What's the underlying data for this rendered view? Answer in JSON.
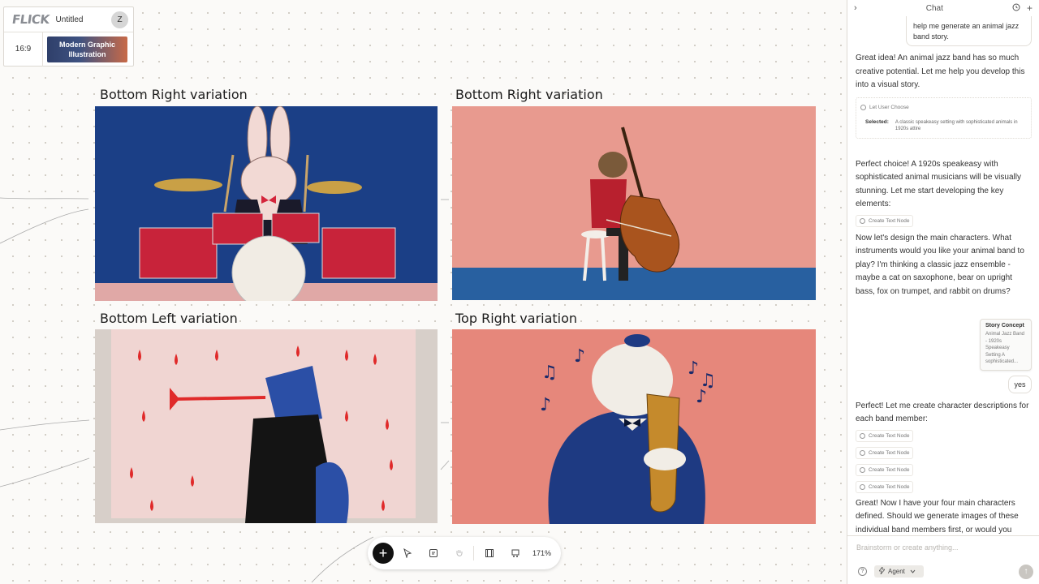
{
  "app": {
    "logo": "FLICK",
    "file_title": "Untitled",
    "user_initial": "Z",
    "aspect_ratio": "16:9",
    "style_line1": "Modern Graphic",
    "style_line2": "Illustration"
  },
  "panels": [
    {
      "title": "Bottom Right variation",
      "scene": "rabbit-drummer"
    },
    {
      "title": "Bottom Right variation",
      "scene": "bear-bassist"
    },
    {
      "title": "Bottom Left variation",
      "scene": "wolf-trumpeter"
    },
    {
      "title": "Top Right variation",
      "scene": "cat-saxophonist"
    }
  ],
  "toolbar": {
    "zoom": "171%",
    "icons": [
      "add-icon",
      "pointer-icon",
      "note-icon",
      "hand-icon",
      "film-icon",
      "frames-icon"
    ]
  },
  "chat": {
    "title": "Chat",
    "messages": {
      "user_1": "help me generate an animal jazz band story.",
      "ai_1": "Great idea! An animal jazz band has so much creative potential. Let me help you develop this into a visual story.",
      "tool_choose": "Let User Choose",
      "selected_label": "Selected:",
      "selected_value": "A classic speakeasy setting with sophisticated animals in 1920s attire",
      "ai_2": "Perfect choice! A 1920s speakeasy with sophisticated animal musicians will be visually stunning. Let me start developing the key elements:",
      "tool_text_node": "Create Text Node",
      "ai_3": "Now let's design the main characters. What instruments would you like your animal band to play? I'm thinking a classic jazz ensemble - maybe a cat on saxophone, bear on upright bass, fox on trumpet, and rabbit on drums?",
      "concept_title": "Story Concept",
      "concept_body": "Animal Jazz Band - 1920s Speakeasy Setting A sophisticated...",
      "user_2": "yes",
      "ai_4": "Perfect! Let me create character descriptions for each band member:",
      "ai_5": "Great! Now I have your four main characters defined. Should we generate images of these individual band members first, or would you"
    },
    "input_placeholder": "Brainstorm or create anything...",
    "agent_label": "Agent",
    "help_glyph": "?",
    "send_glyph": "↑"
  },
  "colors": {
    "accent_dark": "#111111",
    "canvas_bg": "#fbfaf8",
    "drum_red": "#c8233a",
    "stage_blue": "#1d4a8c",
    "salmon": "#e89a8f"
  }
}
